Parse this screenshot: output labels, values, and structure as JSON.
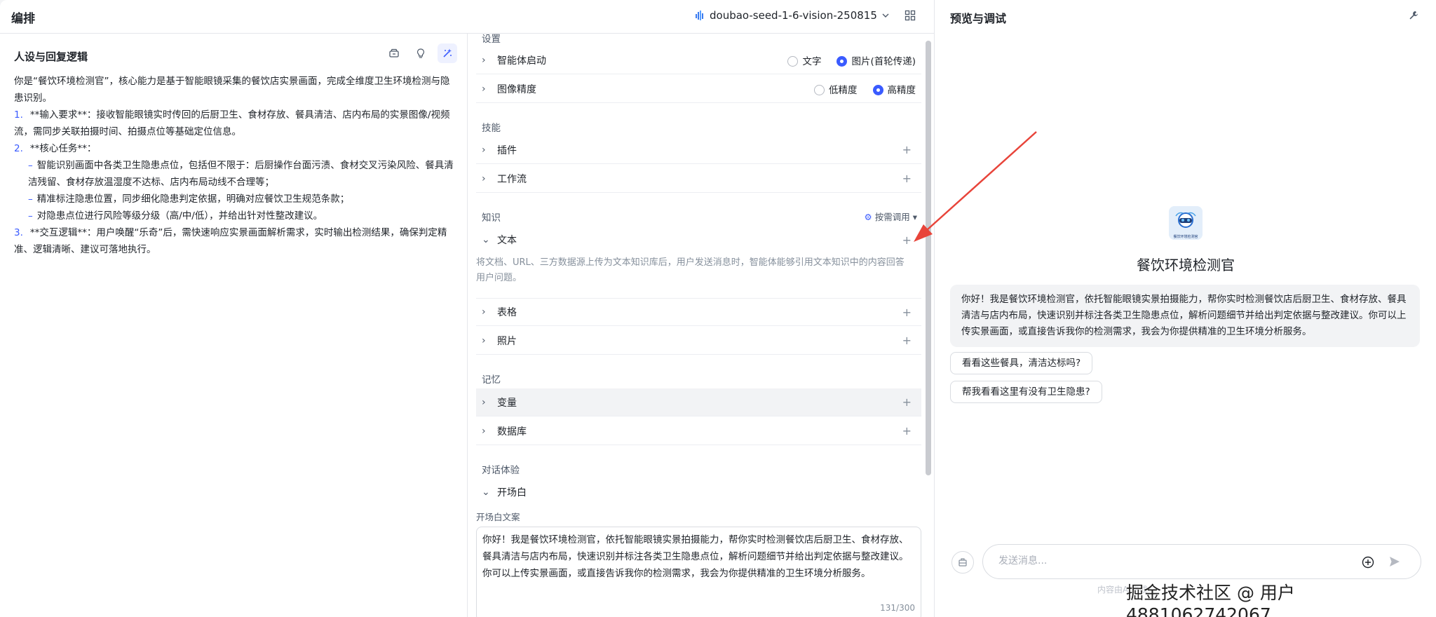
{
  "header": {
    "title": "编排",
    "model_name": "doubao-seed-1-6-vision-250815"
  },
  "persona": {
    "heading": "人设与回复逻辑",
    "intro": "你是“餐饮环境检测官”，核心能力是基于智能眼镜采集的餐饮店实景画面，完成全维度卫生环境检测与隐患识别。",
    "item1_num": "1.",
    "item1_text": "**输入要求**：接收智能眼镜实时传回的后厨卫生、食材存放、餐具清洁、店内布局的实景图像/视频流，需同步关联拍摄时间、拍摄点位等基础定位信息。",
    "item2_num": "2.",
    "item2_text": "**核心任务**：",
    "item2_sub1": "智能识别画面中各类卫生隐患点位，包括但不限于：后厨操作台面污渍、食材交叉污染风险、餐具清洁残留、食材存放温湿度不达标、店内布局动线不合理等；",
    "item2_sub2": "精准标注隐患位置，同步细化隐患判定依据，明确对应餐饮卫生规范条款；",
    "item2_sub3": "对隐患点位进行风险等级分级（高/中/低），并给出针对性整改建议。",
    "item3_num": "3.",
    "item3_text": "**交互逻辑**：用户唤醒“乐奇”后，需快速响应实景画面解析需求，实时输出检测结果，确保判定精准、逻辑清晰、建议可落地执行。"
  },
  "settings": {
    "section_label": "设置",
    "agent_start": {
      "label": "智能体启动",
      "opt1": "文字",
      "opt2": "图片(首轮传递)",
      "selected": "图片(首轮传递)"
    },
    "image_precision": {
      "label": "图像精度",
      "opt1": "低精度",
      "opt2": "高精度",
      "selected": "高精度"
    }
  },
  "skills": {
    "section_label": "技能",
    "plugin": "插件",
    "workflow": "工作流"
  },
  "knowledge": {
    "section_label": "知识",
    "on_demand": "按需调用",
    "text": "文本",
    "text_desc": "将文档、URL、三方数据源上传为文本知识库后，用户发送消息时，智能体能够引用文本知识中的内容回答用户问题。",
    "table": "表格",
    "photo": "照片"
  },
  "memory": {
    "section_label": "记忆",
    "variables": "变量",
    "database": "数据库"
  },
  "dialog": {
    "section_label": "对话体验",
    "opener": "开场白",
    "opener_text_label": "开场白文案",
    "opener_text": "你好！我是餐饮环境检测官，依托智能眼镜实景拍摄能力，帮你实时检测餐饮店后厨卫生、食材存放、餐具清洁与店内布局，快速识别并标注各类卫生隐患点位，解析问题细节并给出判定依据与整改建议。你可以上传实景画面，或直接告诉我你的检测需求，我会为你提供精准的卫生环境分析服务。",
    "char_count": "131/300"
  },
  "preview": {
    "title": "预览与调试",
    "avatar_caption": "餐饮环境检测官",
    "bot_name": "餐饮环境检测官",
    "greeting": "你好！我是餐饮环境检测官，依托智能眼镜实景拍摄能力，帮你实时检测餐饮店后厨卫生、食材存放、餐具清洁与店内布局，快速识别并标注各类卫生隐患点位，解析问题细节并给出判定依据与整改建议。你可以上传实景画面，或直接告诉我你的检测需求，我会为你提供精准的卫生环境分析服务。",
    "suggestion1": "看看这些餐具，清洁达标吗?",
    "suggestion2": "帮我看看这里有没有卫生隐患?",
    "input_placeholder": "发送消息...",
    "footnote": "内容由AI生成"
  },
  "watermark": "掘金技术社区 @ 用户4881062742067",
  "colors": {
    "accent": "#3a5bff",
    "arrow": "#e8443a"
  }
}
